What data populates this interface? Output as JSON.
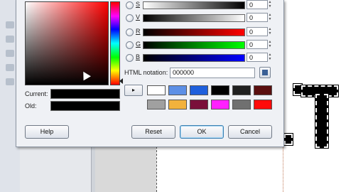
{
  "colors": {
    "accent": "#2f6fdc",
    "dialog_bg": "#eff1f5"
  },
  "color_area": {
    "saturation_value_icon": "sv-field",
    "hue_icon": "hue-bar"
  },
  "swatches": {
    "current_label": "Current:",
    "old_label": "Old:"
  },
  "sliders": [
    {
      "label": "S",
      "value": "0",
      "from": "#ffffff",
      "to": "#000000"
    },
    {
      "label": "V",
      "value": "0",
      "from": "#000000",
      "to": "#ffffff"
    },
    {
      "label": "R",
      "value": "0",
      "from": "#000000",
      "to": "#ff0000"
    },
    {
      "label": "G",
      "value": "0",
      "from": "#000000",
      "to": "#00ff00"
    },
    {
      "label": "B",
      "value": "0",
      "from": "#000000",
      "to": "#0000ff"
    }
  ],
  "html_notation": {
    "label": "HTML notation:",
    "value": "000000"
  },
  "history": {
    "arrow_glyph": "▸",
    "row1": [
      "#ffffff",
      "#5c8fe6",
      "#1e5fdc",
      "#000000",
      "#202020",
      "#5a0f0f"
    ],
    "row2": [
      "#a0a0a0",
      "#f2b23c",
      "#7a0f3a",
      "#ff20ff",
      "#707070",
      "#ff0a0a"
    ]
  },
  "buttons": {
    "help": "Help",
    "reset": "Reset",
    "ok": "OK",
    "cancel": "Cancel"
  }
}
